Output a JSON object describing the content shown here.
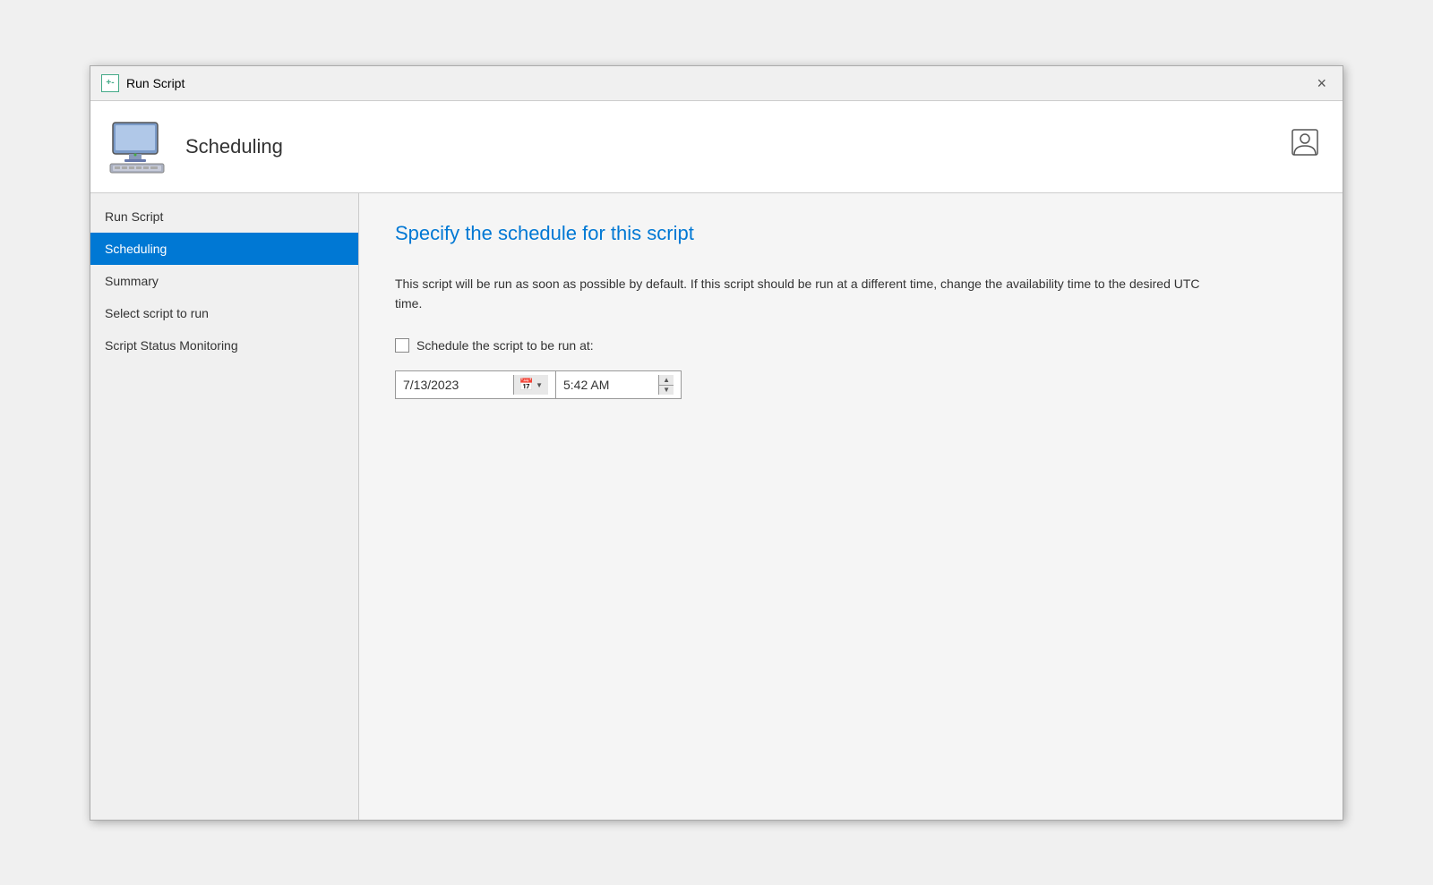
{
  "titleBar": {
    "icon": "+-",
    "title": "Run Script",
    "closeLabel": "×"
  },
  "header": {
    "title": "Scheduling",
    "userIconSymbol": "👤"
  },
  "sidebar": {
    "items": [
      {
        "id": "run-script",
        "label": "Run Script",
        "active": false
      },
      {
        "id": "scheduling",
        "label": "Scheduling",
        "active": true
      },
      {
        "id": "summary",
        "label": "Summary",
        "active": false
      },
      {
        "id": "select-script",
        "label": "Select script to run",
        "active": false
      },
      {
        "id": "script-status",
        "label": "Script Status Monitoring",
        "active": false
      }
    ]
  },
  "content": {
    "heading": "Specify the schedule for this script",
    "description": "This script will be run as soon as possible by default. If this script should be run at a different time, change the availability time to the desired UTC time.",
    "checkboxLabel": "Schedule the script to be run at:",
    "dateValue": "7/13/2023",
    "timeValue": "5:42 AM"
  }
}
